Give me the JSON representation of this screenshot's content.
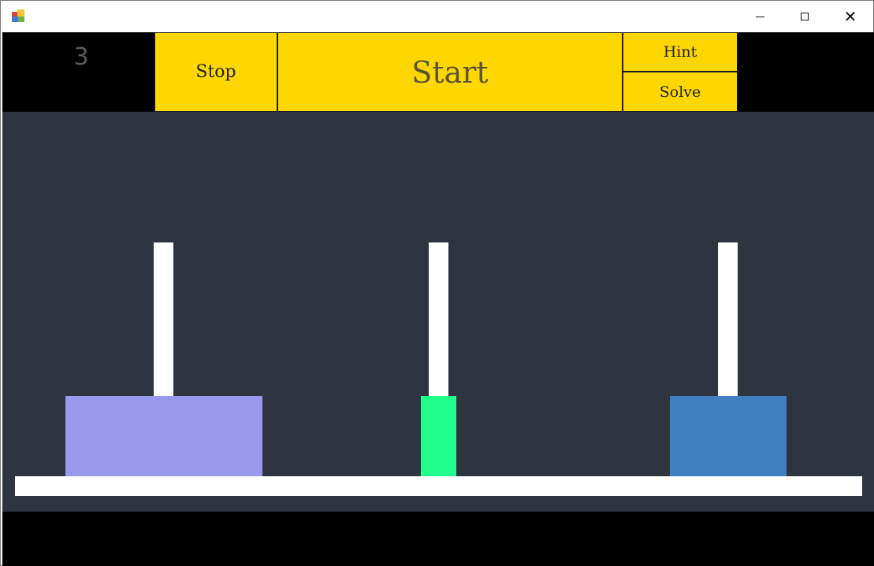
{
  "window": {
    "title": "",
    "controls": {
      "minimize_icon": "minimize-icon",
      "maximize_icon": "maximize-icon",
      "close_icon": "close-icon"
    }
  },
  "toolbar": {
    "move_count": "3",
    "stop_label": "Stop",
    "start_label": "Start",
    "hint_label": "Hint",
    "solve_label": "Solve",
    "button_color": "#ffd700",
    "background_color": "#000000"
  },
  "board": {
    "background_color": "#2e3440",
    "rods": [
      {
        "name": "left",
        "disks": [
          {
            "color": "#9999ee"
          }
        ]
      },
      {
        "name": "middle",
        "disks": [
          {
            "color": "#22ff8c"
          }
        ]
      },
      {
        "name": "right",
        "disks": [
          {
            "color": "#4080c0"
          }
        ]
      }
    ]
  }
}
